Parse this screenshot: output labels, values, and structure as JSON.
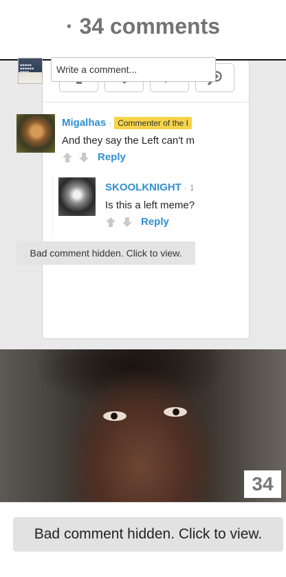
{
  "header": {
    "title": "· 34 comments"
  },
  "vote_bar": {
    "buttons": [
      {
        "icon": "upvote-icon"
      },
      {
        "icon": "downvote-icon"
      },
      {
        "icon": "comment-icon"
      },
      {
        "icon": "zoom-icon"
      }
    ]
  },
  "composer": {
    "placeholder": "Write a comment..."
  },
  "comments": [
    {
      "user": "Migalhas",
      "badge": "Commenter of the I",
      "text": "And they say the Left can't m",
      "reply_label": "Reply"
    },
    {
      "user": "SKOOLKNIGHT",
      "time": "1",
      "text": "Is this a left meme?",
      "reply_label": "Reply"
    }
  ],
  "hidden_notice_small": "Bad comment hidden. Click to view.",
  "post": {
    "comment_count": "34"
  },
  "hidden_notice_large": "Bad comment hidden. Click to view.",
  "colors": {
    "link": "#2f8fd0",
    "badge": "#f6d449"
  }
}
